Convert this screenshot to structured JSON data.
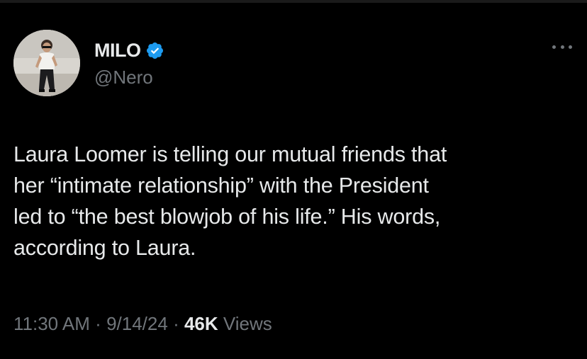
{
  "tweet": {
    "author": {
      "display_name": "MILO",
      "handle": "@Nero",
      "verified": true,
      "avatar_icon": "profile-photo",
      "verified_icon": "verified-badge-icon",
      "verified_color": "#1d9bf0"
    },
    "more_icon": "more-options-icon",
    "text_lines": [
      "Laura Loomer is telling our mutual friends that",
      "her “intimate relationship” with the President",
      "led to “the best blowjob of his life.” His words,",
      "according to Laura."
    ],
    "meta": {
      "time": "11:30 AM",
      "separator": "·",
      "date": "9/14/24",
      "views_count": "46K",
      "views_label": "Views"
    }
  },
  "colors": {
    "background": "#000000",
    "text_primary": "#e7e9ea",
    "text_secondary": "#71767b"
  }
}
